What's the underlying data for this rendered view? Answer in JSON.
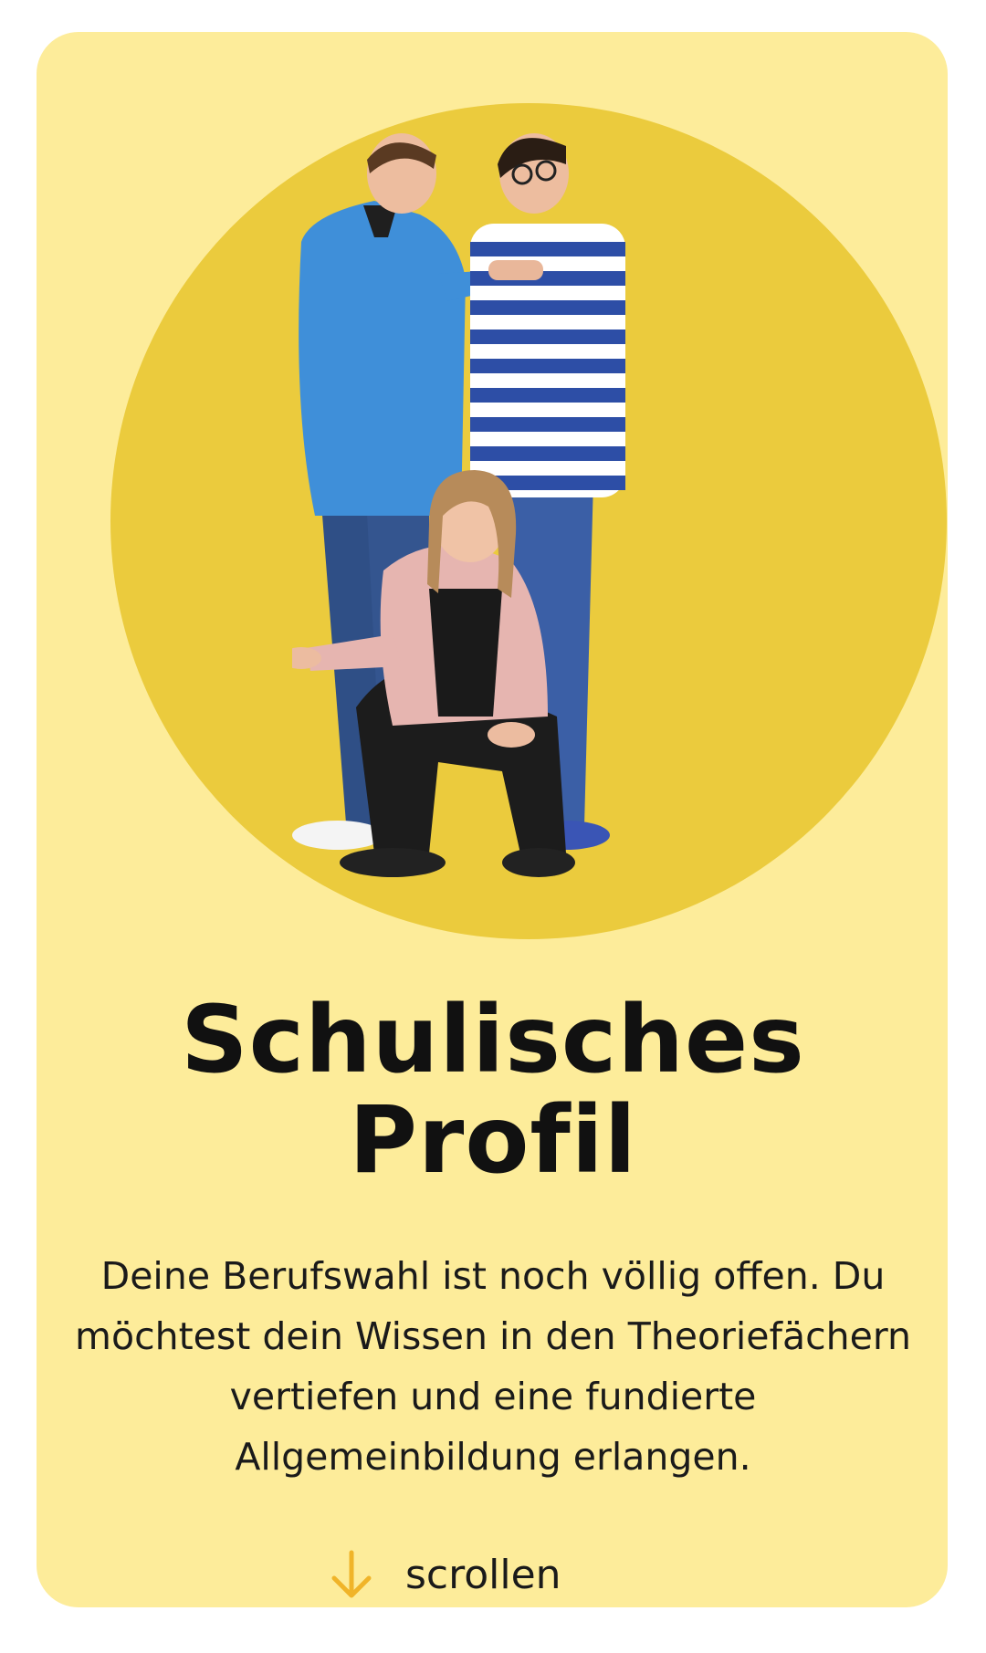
{
  "hero": {
    "image_alt": "Drei Jugendliche posieren vor gelbem Kreis"
  },
  "content": {
    "title_line1": "Schulisches",
    "title_line2": "Profil",
    "description": "Deine Berufswahl ist noch völlig offen. Du möchtest dein Wissen in den Theo­riefächern vertiefen und eine fundierte Allgemeinbildung erlangen.",
    "scroll_label": "scrollen",
    "scroll_icon": "arrow-down-icon"
  },
  "colors": {
    "card_background": "#fdec9a",
    "circle": "#ebcb3d",
    "accent_arrow": "#f0b429",
    "text": "#111111"
  }
}
